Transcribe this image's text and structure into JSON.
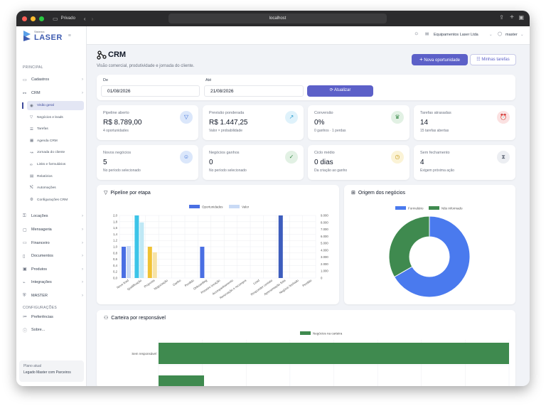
{
  "browser": {
    "private_label": "Privado",
    "url": "localhost"
  },
  "brand": {
    "logo_small": "Sistema",
    "logo_text": "LASER"
  },
  "topbar": {
    "company": "Equipamentos Laser Ltda",
    "user": "master"
  },
  "sidebar": {
    "section_principal": "PRINCIPAL",
    "items": [
      {
        "label": "Cadastros",
        "icon": "folder-icon"
      },
      {
        "label": "CRM",
        "icon": "crm-icon"
      }
    ],
    "crm_sub": [
      {
        "label": "Visão geral",
        "icon": "eye-icon"
      },
      {
        "label": "Negócios e leads",
        "icon": "funnel-icon"
      },
      {
        "label": "Tarefas",
        "icon": "list-icon"
      },
      {
        "label": "Agenda CRM",
        "icon": "calendar-icon"
      },
      {
        "label": "Jornada do cliente",
        "icon": "route-icon"
      },
      {
        "label": "Links e formulários",
        "icon": "link-icon"
      },
      {
        "label": "Relatórios",
        "icon": "file-icon"
      },
      {
        "label": "Automações",
        "icon": "flow-icon"
      },
      {
        "label": "Configurações CRM",
        "icon": "gear-icon"
      }
    ],
    "items2": [
      {
        "label": "Locações",
        "icon": "key-icon"
      },
      {
        "label": "Mensageria",
        "icon": "chat-icon"
      },
      {
        "label": "Financeiro",
        "icon": "wallet-icon"
      },
      {
        "label": "Documentos",
        "icon": "doc-icon"
      },
      {
        "label": "Produtos",
        "icon": "box-icon"
      },
      {
        "label": "Integrações",
        "icon": "plug-icon"
      },
      {
        "label": "MASTER",
        "icon": "shield-icon"
      }
    ],
    "section_config": "CONFIGURAÇÕES",
    "items3": [
      {
        "label": "Preferências",
        "icon": "sliders-icon"
      },
      {
        "label": "Sobre...",
        "icon": "info-icon"
      }
    ],
    "plan_label": "Plano atual",
    "plan_value": "Legado Master com Parceiros"
  },
  "page": {
    "title": "CRM",
    "subtitle": "Visão comercial, produtividade e jornada do cliente.",
    "new_button": "Nova oportunidade",
    "tasks_button": "Minhas tarefas"
  },
  "filters": {
    "from_label": "De",
    "from_value": "01/08/2026",
    "to_label": "Até",
    "to_value": "21/08/2026",
    "refresh": "Atualizar"
  },
  "kpis": [
    {
      "label": "Pipeline aberto",
      "value": "R$ 8.789,00",
      "sub": "4 oportunidades",
      "icon": "funnel-icon",
      "color": "#dbe7fb",
      "fg": "#3b6fd8"
    },
    {
      "label": "Previsão ponderada",
      "value": "R$ 1.447,25",
      "sub": "Valor × probabilidade",
      "icon": "trend-icon",
      "color": "#dff2fb",
      "fg": "#2a9fd0"
    },
    {
      "label": "Conversão",
      "value": "0%",
      "sub": "0 ganhos · 1 perdas",
      "icon": "trophy-icon",
      "color": "#e2f1e4",
      "fg": "#3a8a4a"
    },
    {
      "label": "Tarefas atrasadas",
      "value": "14",
      "sub": "15 tarefas abertas",
      "icon": "alarm-icon",
      "color": "#fbe1e1",
      "fg": "#d64545"
    },
    {
      "label": "Novos negócios",
      "value": "5",
      "sub": "No período selecionado",
      "icon": "user-plus-icon",
      "color": "#dbe7fb",
      "fg": "#3b6fd8"
    },
    {
      "label": "Negócios ganhos",
      "value": "0",
      "sub": "No período selecionado",
      "icon": "check-icon",
      "color": "#e2f1e4",
      "fg": "#3a8a4a"
    },
    {
      "label": "Ciclo médio",
      "value": "0 dias",
      "sub": "Da criação ao ganho",
      "icon": "clock-icon",
      "color": "#fbf3d6",
      "fg": "#c79a1a"
    },
    {
      "label": "Sem fechamento",
      "value": "4",
      "sub": "Exigem próxima ação",
      "icon": "hourglass-icon",
      "color": "#eceef2",
      "fg": "#6b7280"
    }
  ],
  "pipeline": {
    "title": "Pipeline por etapa"
  },
  "origin": {
    "title": "Origem dos negócios"
  },
  "portfolio": {
    "title": "Carteira por responsável"
  },
  "chart_data": [
    {
      "type": "bar",
      "title": "Pipeline por etapa",
      "categories": [
        "Novo lead",
        "Qualificação",
        "Proposta",
        "Negociação",
        "Ganho",
        "Perdido",
        "Onboarding",
        "Primeiro locação",
        "Acompanhamento",
        "Renovação e recompra",
        "Lead",
        "Responder contato",
        "Apresentação feita",
        "Negócio fechado",
        "Perdido"
      ],
      "series": [
        {
          "name": "Oportunidades",
          "axis": "left",
          "values": [
            1,
            2,
            1,
            0,
            0,
            0,
            1,
            0,
            0,
            0,
            0,
            0,
            2,
            0,
            0
          ]
        },
        {
          "name": "Valor",
          "axis": "right",
          "values": [
            4600,
            8000,
            3700,
            0,
            0,
            0,
            0,
            0,
            0,
            0,
            0,
            0,
            0,
            0,
            0
          ]
        }
      ],
      "ylim": [
        0,
        2
      ],
      "y2lim": [
        0,
        9000
      ],
      "yticks": [
        "2,0",
        "1,8",
        "1,6",
        "1,4",
        "1,2",
        "1,0",
        "0,8",
        "0,6",
        "0,4",
        "0,2",
        "0,0"
      ],
      "y2ticks": [
        "9.000",
        "8.000",
        "7.000",
        "6.000",
        "5.000",
        "4.000",
        "3.000",
        "2.000",
        "1.000",
        "0"
      ]
    },
    {
      "type": "pie",
      "title": "Origem dos negócios",
      "labels": [
        "Formulário",
        "Não informado"
      ],
      "values": [
        2,
        1
      ],
      "colors": [
        "#4a7aee",
        "#3f8a4f"
      ]
    },
    {
      "type": "bar",
      "title": "Carteira por responsável",
      "categories": [
        "Sem responsável"
      ],
      "series": [
        {
          "name": "Negócios na carteira",
          "values": [
            10
          ]
        }
      ]
    }
  ]
}
